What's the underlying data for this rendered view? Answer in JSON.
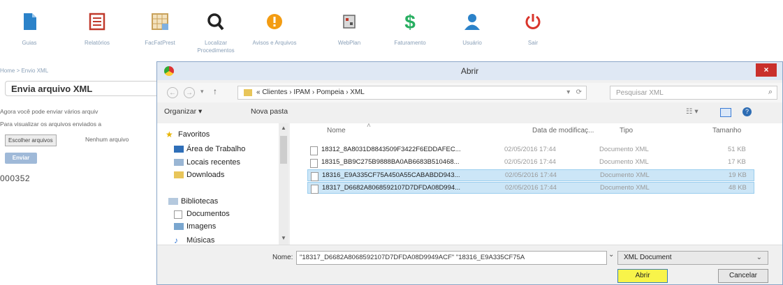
{
  "toolbar": {
    "items": [
      {
        "label": "Guias",
        "icon": "document-icon",
        "color": "#2b82c9"
      },
      {
        "label": "Relatórios",
        "icon": "report-icon",
        "color": "#c0392b"
      },
      {
        "label": "FacFatPrest",
        "icon": "grid-icon",
        "color": "#c8a15a"
      },
      {
        "label": "Localizar Procedimentos",
        "icon": "search-icon",
        "color": "#222222"
      },
      {
        "label": "Avisos e Arquivos",
        "icon": "alert-icon",
        "color": "#f39c12"
      },
      {
        "label": "WebPlan",
        "icon": "webplan-icon",
        "color": "#7a7a7a"
      },
      {
        "label": "Faturamento",
        "icon": "dollar-icon",
        "color": "#27ae60"
      },
      {
        "label": "Usuário",
        "icon": "user-icon",
        "color": "#2b82c9"
      },
      {
        "label": "Sair",
        "icon": "power-icon",
        "color": "#d9342b"
      }
    ]
  },
  "page": {
    "breadcrumb": "Home > Envio XML",
    "title": "Envia arquivo XML",
    "line1": "Agora você pode enviar vários arquiv",
    "line2": "Para visualizar os arquivos enviados a",
    "choose_button": "Escolher arquivos",
    "no_file": "Nenhum arquivo",
    "send_button": "Enviar",
    "code": "000352"
  },
  "dialog": {
    "title": "Abrir",
    "close": "×",
    "path": [
      "Clientes",
      "IPAM",
      "Pompeia",
      "XML"
    ],
    "path_text": "«  Clientes  ›  IPAM  ›  Pompeia  ›  XML",
    "search_placeholder": "Pesquisar XML",
    "organize": "Organizar ▾",
    "new_folder": "Nova pasta",
    "nav": {
      "favorites": "Favoritos",
      "desktop": "Área de Trabalho",
      "recent": "Locais recentes",
      "downloads": "Downloads",
      "libraries": "Bibliotecas",
      "documents": "Documentos",
      "images": "Imagens",
      "more": "Músicas"
    },
    "columns": {
      "name": "Nome",
      "date": "Data de modificaç...",
      "type": "Tipo",
      "size": "Tamanho"
    },
    "files": [
      {
        "name": "18312_8A8031D8843509F3422F6EDDAFEC...",
        "date": "02/05/2016 17:44",
        "type": "Documento XML",
        "size": "51 KB",
        "selected": false
      },
      {
        "name": "18315_BB9C275B9888BA0AB6683B510468...",
        "date": "02/05/2016 17:44",
        "type": "Documento XML",
        "size": "17 KB",
        "selected": false
      },
      {
        "name": "18316_E9A335CF75A450A55CABABDD943...",
        "date": "02/05/2016 17:44",
        "type": "Documento XML",
        "size": "19 KB",
        "selected": true
      },
      {
        "name": "18317_D6682A8068592107D7DFDA08D994...",
        "date": "02/05/2016 17:44",
        "type": "Documento XML",
        "size": "48 KB",
        "selected": true
      }
    ],
    "name_label": "Nome:",
    "name_value": "\"18317_D6682A8068592107D7DFDA08D9949ACF\" \"18316_E9A335CF75A",
    "type_value": "XML Document",
    "open_button": "Abrir",
    "cancel_button": "Cancelar"
  }
}
